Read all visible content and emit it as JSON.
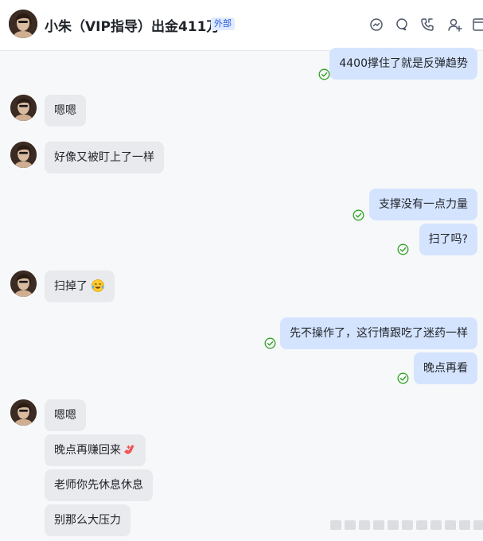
{
  "header": {
    "title": "小朱（VIP指导）出金411万",
    "badge": "外部",
    "tools": [
      "chat-icon",
      "search-icon",
      "phone-icon",
      "add-member-icon",
      "more-icon"
    ]
  },
  "messages": [
    {
      "direction": "out",
      "text": "4400撑住了就是反弹趋势",
      "read": true
    },
    {
      "direction": "in",
      "text": "嗯嗯"
    },
    {
      "direction": "in",
      "text": "好像又被盯上了一样"
    },
    {
      "direction": "out",
      "text": "支撑没有一点力量",
      "read": true
    },
    {
      "direction": "out",
      "text": "扫了吗?",
      "read": true
    },
    {
      "direction": "in",
      "text": "扫掉了",
      "emoji": "crying-laughing-emoji"
    },
    {
      "direction": "out",
      "text": "先不操作了，这行情跟吃了迷药一样",
      "read": true
    },
    {
      "direction": "out",
      "text": "晚点再看",
      "read": true
    },
    {
      "direction": "in",
      "text": "嗯嗯"
    },
    {
      "direction": "in",
      "text": "晚点再赚回来",
      "emoji": "strong-arm-emoji"
    },
    {
      "direction": "in",
      "text": "老师你先休息休息"
    },
    {
      "direction": "in",
      "text": "别那么大压力"
    }
  ],
  "colors": {
    "incoming_bubble": "#e9eaed",
    "outgoing_bubble": "#d5e4fe",
    "read_check": "#2ea121",
    "badge_text": "#245bdb"
  }
}
